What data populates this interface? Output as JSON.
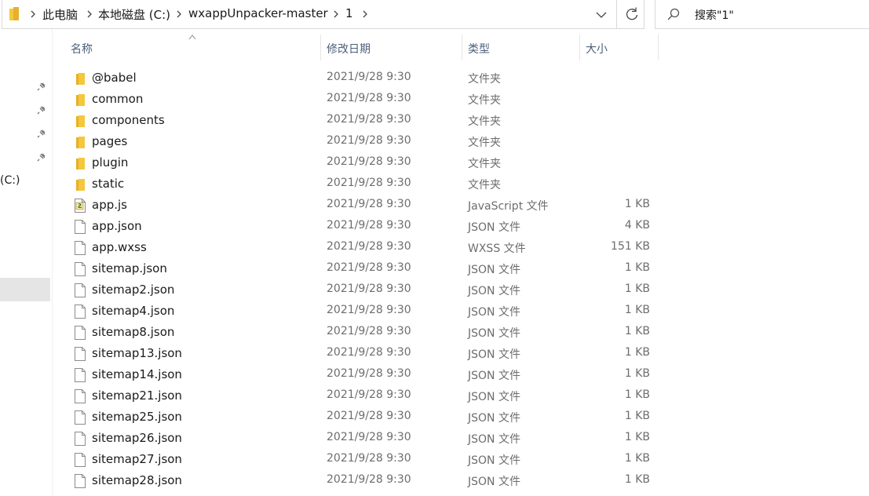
{
  "breadcrumb": {
    "items": [
      "此电脑",
      "本地磁盘 (C:)",
      "wxappUnpacker-master",
      "1"
    ]
  },
  "search": {
    "placeholder": "搜索\"1\""
  },
  "nav": {
    "drive_label": "(C:)"
  },
  "columns": {
    "name": "名称",
    "date": "修改日期",
    "type": "类型",
    "size": "大小"
  },
  "files": [
    {
      "name": "@babel",
      "date": "2021/9/28 9:30",
      "type": "文件夹",
      "size": "",
      "icon": "folder-icon"
    },
    {
      "name": "common",
      "date": "2021/9/28 9:30",
      "type": "文件夹",
      "size": "",
      "icon": "folder-icon"
    },
    {
      "name": "components",
      "date": "2021/9/28 9:30",
      "type": "文件夹",
      "size": "",
      "icon": "folder-icon"
    },
    {
      "name": "pages",
      "date": "2021/9/28 9:30",
      "type": "文件夹",
      "size": "",
      "icon": "folder-icon"
    },
    {
      "name": "plugin",
      "date": "2021/9/28 9:30",
      "type": "文件夹",
      "size": "",
      "icon": "folder-icon"
    },
    {
      "name": "static",
      "date": "2021/9/28 9:30",
      "type": "文件夹",
      "size": "",
      "icon": "folder-icon"
    },
    {
      "name": "app.js",
      "date": "2021/9/28 9:30",
      "type": "JavaScript 文件",
      "size": "1 KB",
      "icon": "js-file-icon"
    },
    {
      "name": "app.json",
      "date": "2021/9/28 9:30",
      "type": "JSON 文件",
      "size": "4 KB",
      "icon": "file-icon"
    },
    {
      "name": "app.wxss",
      "date": "2021/9/28 9:30",
      "type": "WXSS 文件",
      "size": "151 KB",
      "icon": "file-icon"
    },
    {
      "name": "sitemap.json",
      "date": "2021/9/28 9:30",
      "type": "JSON 文件",
      "size": "1 KB",
      "icon": "file-icon"
    },
    {
      "name": "sitemap2.json",
      "date": "2021/9/28 9:30",
      "type": "JSON 文件",
      "size": "1 KB",
      "icon": "file-icon"
    },
    {
      "name": "sitemap4.json",
      "date": "2021/9/28 9:30",
      "type": "JSON 文件",
      "size": "1 KB",
      "icon": "file-icon"
    },
    {
      "name": "sitemap8.json",
      "date": "2021/9/28 9:30",
      "type": "JSON 文件",
      "size": "1 KB",
      "icon": "file-icon"
    },
    {
      "name": "sitemap13.json",
      "date": "2021/9/28 9:30",
      "type": "JSON 文件",
      "size": "1 KB",
      "icon": "file-icon"
    },
    {
      "name": "sitemap14.json",
      "date": "2021/9/28 9:30",
      "type": "JSON 文件",
      "size": "1 KB",
      "icon": "file-icon"
    },
    {
      "name": "sitemap21.json",
      "date": "2021/9/28 9:30",
      "type": "JSON 文件",
      "size": "1 KB",
      "icon": "file-icon"
    },
    {
      "name": "sitemap25.json",
      "date": "2021/9/28 9:30",
      "type": "JSON 文件",
      "size": "1 KB",
      "icon": "file-icon"
    },
    {
      "name": "sitemap26.json",
      "date": "2021/9/28 9:30",
      "type": "JSON 文件",
      "size": "1 KB",
      "icon": "file-icon"
    },
    {
      "name": "sitemap27.json",
      "date": "2021/9/28 9:30",
      "type": "JSON 文件",
      "size": "1 KB",
      "icon": "file-icon"
    },
    {
      "name": "sitemap28.json",
      "date": "2021/9/28 9:30",
      "type": "JSON 文件",
      "size": "1 KB",
      "icon": "file-icon"
    }
  ],
  "colors": {
    "folder": "#f5c73d",
    "header_text": "#4c607a",
    "selected_nav": "#e5e5e5"
  }
}
